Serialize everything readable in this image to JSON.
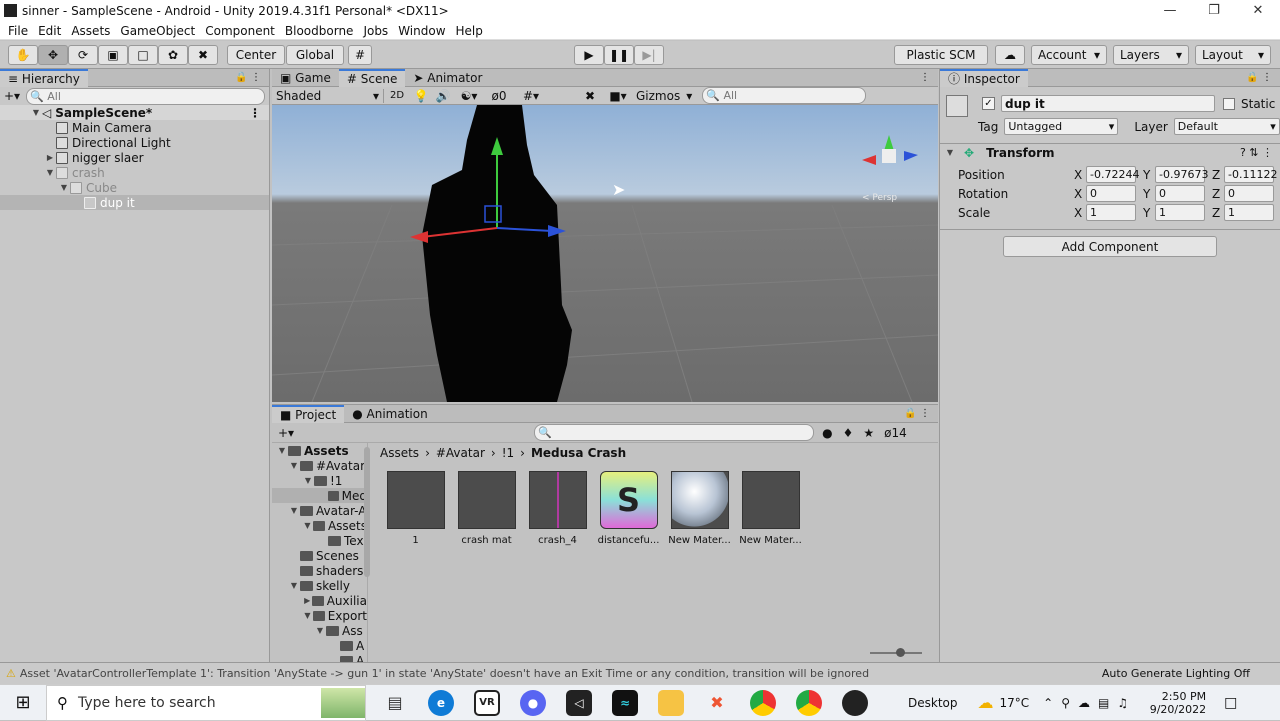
{
  "window": {
    "title": "sinner - SampleScene - Android - Unity 2019.4.31f1 Personal* <DX11>"
  },
  "menu": [
    "File",
    "Edit",
    "Assets",
    "GameObject",
    "Component",
    "Bloodborne",
    "Jobs",
    "Window",
    "Help"
  ],
  "toolbar": {
    "center": "Center",
    "global": "Global",
    "plastic": "Plastic SCM",
    "account": "Account",
    "layers": "Layers",
    "layout": "Layout"
  },
  "hierarchy": {
    "tab": "Hierarchy",
    "search_placeholder": "All",
    "scene": "SampleScene*",
    "items": [
      {
        "label": "Main Camera"
      },
      {
        "label": "Directional Light"
      },
      {
        "label": "nigger slaer"
      },
      {
        "label": "crash"
      },
      {
        "label": "Cube"
      },
      {
        "label": "dup it"
      }
    ]
  },
  "scene_tabs": [
    "Game",
    "Scene",
    "Animator"
  ],
  "scene_toolbar": {
    "shading": "Shaded",
    "mode2d": "2D",
    "hidden_count": "0",
    "gizmos": "Gizmos",
    "search_placeholder": "All",
    "persp": "< Persp"
  },
  "inspector": {
    "tab": "Inspector",
    "object_name": "dup it",
    "static": "Static",
    "tag_label": "Tag",
    "tag": "Untagged",
    "layer_label": "Layer",
    "layer": "Default",
    "component": "Transform",
    "rows": [
      {
        "label": "Position",
        "x": "-0.72244",
        "y": "-0.97673",
        "z": "-0.11122"
      },
      {
        "label": "Rotation",
        "x": "0",
        "y": "0",
        "z": "0"
      },
      {
        "label": "Scale",
        "x": "1",
        "y": "1",
        "z": "1"
      }
    ],
    "axis": {
      "x": "X",
      "y": "Y",
      "z": "Z"
    },
    "add_component": "Add Component"
  },
  "project": {
    "tabs": [
      "Project",
      "Animation"
    ],
    "count": "14",
    "breadcrumb": [
      "Assets",
      "#Avatar",
      "!1",
      "Medusa Crash"
    ],
    "tree": [
      {
        "label": "Assets"
      },
      {
        "label": "#Avatar"
      },
      {
        "label": "!1"
      },
      {
        "label": "Med"
      },
      {
        "label": "Avatar-A"
      },
      {
        "label": "Assets"
      },
      {
        "label": "Tex"
      },
      {
        "label": "Scenes"
      },
      {
        "label": "shaders"
      },
      {
        "label": "skelly"
      },
      {
        "label": "Auxilia"
      },
      {
        "label": "Export"
      },
      {
        "label": "Ass"
      },
      {
        "label": "A"
      },
      {
        "label": "A"
      }
    ],
    "assets": [
      {
        "label": "1"
      },
      {
        "label": "crash mat"
      },
      {
        "label": "crash_4"
      },
      {
        "label": "distancefu..."
      },
      {
        "label": "New Mater..."
      },
      {
        "label": "New Mater..."
      }
    ],
    "shader_letter": "S"
  },
  "status": {
    "message": "Asset 'AvatarControllerTemplate 1': Transition 'AnyState -> gun 1' in state 'AnyState' doesn't have an Exit Time or any condition, transition will be ignored",
    "lighting": "Auto Generate Lighting Off"
  },
  "taskbar": {
    "search_placeholder": "Type here to search",
    "desktop": "Desktop",
    "temp": "17°C",
    "time": "2:50 PM",
    "date": "9/20/2022",
    "vr": "VR"
  }
}
